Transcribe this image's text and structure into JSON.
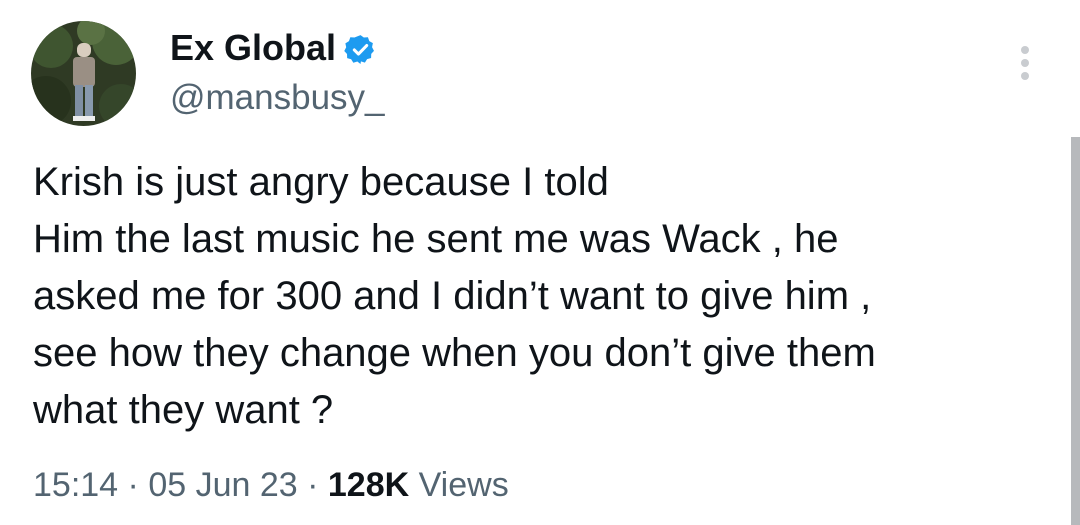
{
  "author": {
    "name": "Ex Global",
    "handle": "@mansbusy_",
    "verified": true
  },
  "icons": {
    "verified": "verified-badge-icon",
    "more": "more-vertical-icon"
  },
  "colors": {
    "verified_blue": "#1d9bf0",
    "text": "#0f1419",
    "secondary": "#536471"
  },
  "tweet": {
    "lines": [
      "Krish is just angry because I told",
      "Him the last music he sent me was Wack , he",
      "asked me for 300 and I didn’t want to give him ,",
      "see how they change when you don’t give them",
      "what they want ?"
    ]
  },
  "meta": {
    "time": "15:14",
    "separator1": " · ",
    "date": "05 Jun 23",
    "separator2": " · ",
    "views_count": "128K",
    "views_label": " Views"
  }
}
